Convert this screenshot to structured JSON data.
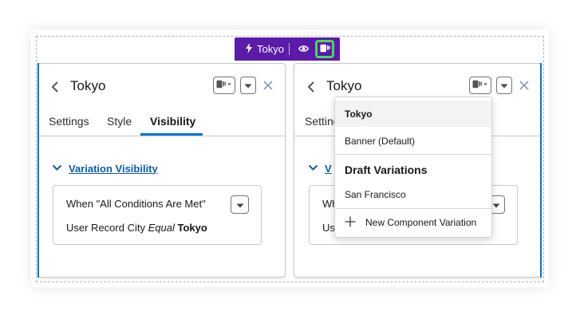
{
  "toolbar": {
    "variation_name": "Tokyo",
    "accent_color": "#5a1ba9",
    "highlight_color": "#4fd55a",
    "icons": [
      "bolt-icon",
      "eye-icon",
      "variation-icon"
    ]
  },
  "left_panel": {
    "title": "Tokyo",
    "tabs": [
      {
        "label": "Settings",
        "active": false
      },
      {
        "label": "Style",
        "active": false
      },
      {
        "label": "Visibility",
        "active": true
      }
    ],
    "section_title": "Variation Visibility",
    "condition": {
      "logic": "When \"All Conditions Are Met\"",
      "field": "User Record City",
      "operator": "Equal",
      "value": "Tokyo"
    }
  },
  "right_panel": {
    "title": "Tokyo",
    "tab_partial": "Setting",
    "section_partial": "V",
    "cond_partial_1": "Wh",
    "cond_partial_2": "Us"
  },
  "dropdown": {
    "items": [
      {
        "label": "Tokyo",
        "selected": true
      },
      {
        "label": "Banner (Default)",
        "selected": false
      }
    ],
    "draft_heading": "Draft Variations",
    "draft_items": [
      {
        "label": "San Francisco"
      }
    ],
    "new_label": "New Component Variation"
  },
  "colors": {
    "link_blue": "#0b5cab",
    "brand_blue": "#0176d3",
    "border": "#c9c9c9"
  }
}
